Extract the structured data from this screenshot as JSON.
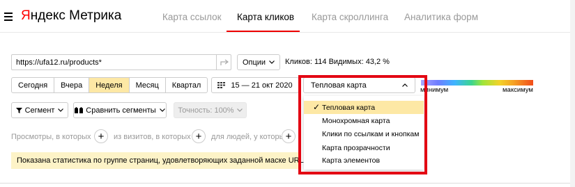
{
  "header": {
    "logo_accent": "Я",
    "logo_rest": "ндекс Метрика",
    "tabs": [
      "Карта ссылок",
      "Карта кликов",
      "Карта скроллинга",
      "Аналитика форм"
    ],
    "active_tab": "Карта кликов"
  },
  "url_bar": {
    "value": "https://ufa12.ru/products*"
  },
  "options_label": "Опции",
  "stats": "Кликов: 114  Видимых: 43,2 %",
  "periods": [
    "Сегодня",
    "Вчера",
    "Неделя",
    "Месяц",
    "Квартал"
  ],
  "active_period": "Неделя",
  "date_range": "15 — 21 окт 2020",
  "map_type": {
    "selected": "Тепловая карта",
    "options": [
      "Тепловая карта",
      "Монохромная карта",
      "Клики по ссылкам и кнопкам",
      "Карта прозрачности",
      "Карта элементов"
    ]
  },
  "legend": {
    "min": "минимум",
    "max": "максимум"
  },
  "segment_label": "Сегмент",
  "compare_label": "Сравнить сегменты",
  "accuracy_label": "Точность: 100%",
  "filters": [
    "Просмотры, в которых",
    "из визитов, в которых",
    "для людей, у которых"
  ],
  "notice": "Показана статистика по группе страниц, удовлетворяющих заданной маске URL.",
  "colors": {
    "highlight": "#e30613",
    "active_bg": "#fde8a5",
    "notice_bg": "#fdf3c7",
    "accent": "#ff0000"
  }
}
